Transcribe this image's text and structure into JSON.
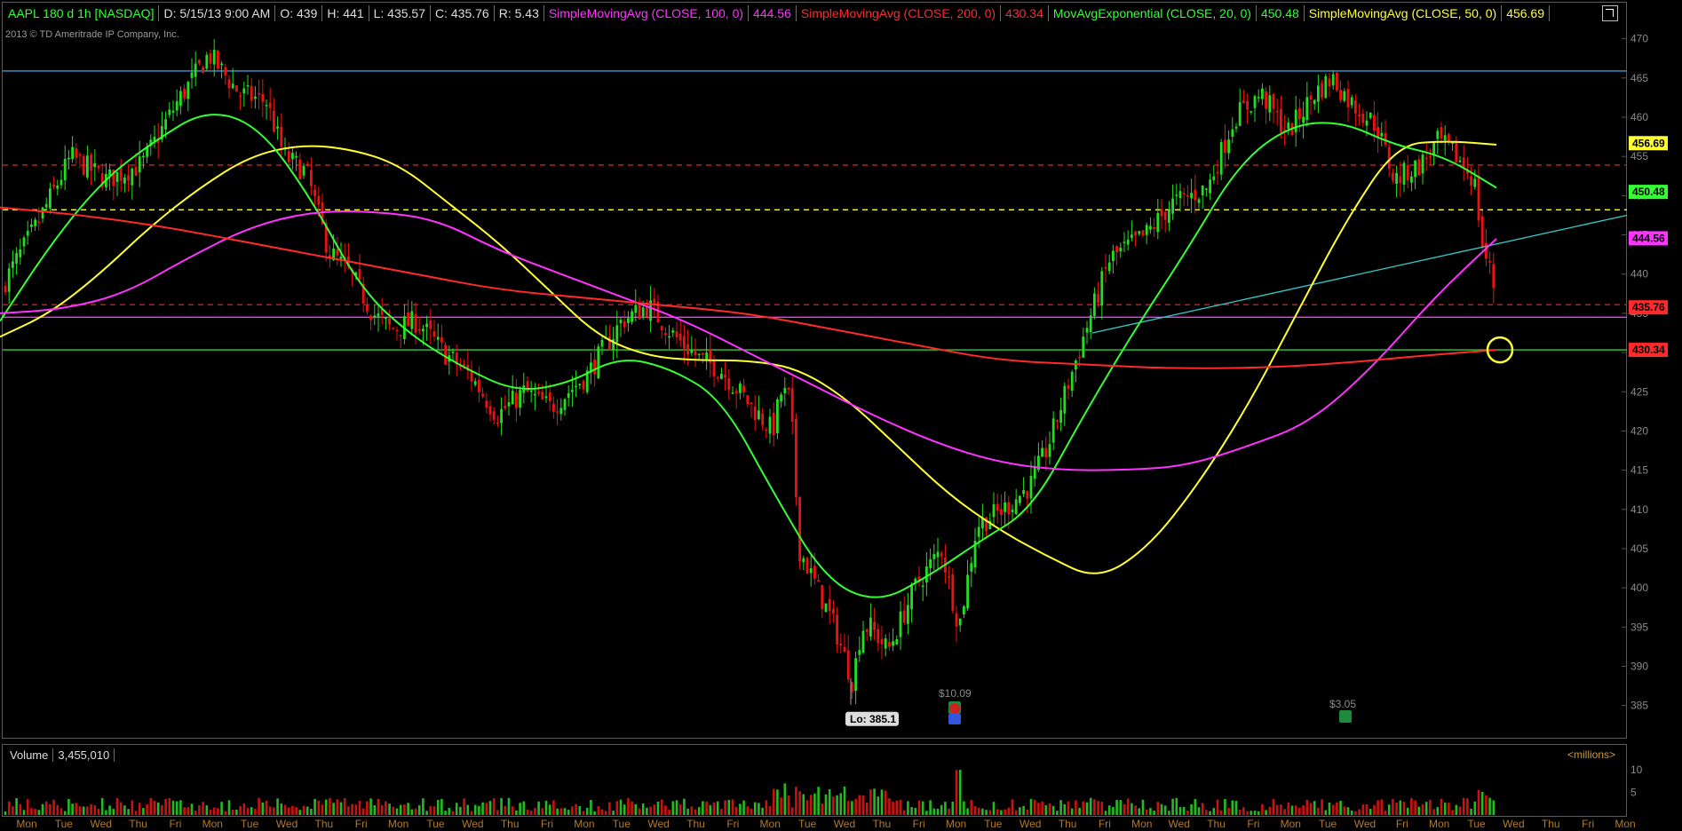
{
  "header": {
    "symbol": "AAPL 180 d 1h [NASDAQ]",
    "date": "D: 5/15/13 9:00 AM",
    "open": "O: 439",
    "high": "H: 441",
    "low": "L: 435.57",
    "close": "C: 435.76",
    "range": "R: 5.43",
    "studies": [
      {
        "label": "SimpleMovingAvg (CLOSE, 100, 0)",
        "value": "444.56",
        "color": "#ff33ff"
      },
      {
        "label": "SimpleMovingAvg (CLOSE, 200, 0)",
        "value": "430.34",
        "color": "#ff2a2a"
      },
      {
        "label": "MovAvgExponential (CLOSE, 20, 0)",
        "value": "450.48",
        "color": "#33ff33"
      },
      {
        "label": "SimpleMovingAvg (CLOSE, 50, 0)",
        "value": "456.69",
        "color": "#ffff33"
      }
    ]
  },
  "copyright": "2013 © TD Ameritrade IP Company, Inc.",
  "volume_panel": {
    "label": "Volume",
    "value": "3,455,010",
    "units": "<millions>",
    "y_ticks": [
      "10",
      "5"
    ]
  },
  "chart_data": {
    "type": "candlestick",
    "y_ticks": [
      470,
      465,
      460,
      455,
      450,
      445,
      440,
      435,
      430,
      425,
      420,
      415,
      410,
      405,
      400,
      395,
      390,
      385
    ],
    "ylim": [
      381,
      472
    ],
    "price_tags": [
      {
        "value": 456.69,
        "label": "456.69",
        "color": "#ffff33"
      },
      {
        "value": 450.48,
        "label": "450.48",
        "color": "#33ff33"
      },
      {
        "value": 444.56,
        "label": "444.56",
        "color": "#ff33ff"
      },
      {
        "value": 435.76,
        "label": "435.76",
        "color": "#ff2a2a"
      },
      {
        "value": 430.34,
        "label": "430.34",
        "color": "#ff2a2a"
      }
    ],
    "low_label": "Lo: 385.1",
    "low_value": 385.1,
    "dividends": [
      "$10.09",
      "$3.05"
    ],
    "day_labels": [
      "Mon",
      "Tue",
      "Wed",
      "Thu",
      "Fri",
      "Mon",
      "Tue",
      "Wed",
      "Thu",
      "Fri",
      "Mon",
      "Tue",
      "Wed",
      "Thu",
      "Fri",
      "Mon",
      "Tue",
      "Wed",
      "Thu",
      "Fri",
      "Mon",
      "Tue",
      "Wed",
      "Thu",
      "Fri",
      "Mon",
      "Tue",
      "Wed",
      "Thu",
      "Fri",
      "Mon",
      "Wed",
      "Thu",
      "Fri",
      "Mon",
      "Tue",
      "Wed",
      "Fri",
      "Mon",
      "Tue",
      "Wed",
      "Thu",
      "Fri",
      "Mon"
    ],
    "horizontal_lines": [
      {
        "value": 465.9,
        "color": "#3a9ad9",
        "style": "solid"
      },
      {
        "value": 453.9,
        "color": "#cc2222",
        "style": "dashed"
      },
      {
        "value": 448.2,
        "color": "#ffff33",
        "style": "dashed"
      },
      {
        "value": 436.1,
        "color": "#cc2222",
        "style": "dashed"
      },
      {
        "value": 434.5,
        "color": "#ff33ff",
        "style": "solid"
      },
      {
        "value": 430.34,
        "color": "#33cc33",
        "style": "solid"
      }
    ],
    "trendline": {
      "from_price": 432.5,
      "to_price": 447.5,
      "color": "#33cccc"
    },
    "series": [
      {
        "name": "SimpleMovingAvg (CLOSE, 50, 0)",
        "color": "#ffff33",
        "values": [
          432,
          435,
          440,
          446,
          451,
          455,
          456.5,
          456,
          454,
          449,
          444,
          438,
          432,
          429.5,
          429,
          429,
          428,
          424,
          418,
          412,
          407.5,
          404,
          401,
          405,
          413,
          423,
          435,
          447,
          456.5,
          457,
          456.5
        ]
      },
      {
        "name": "MovAvgExponential (CLOSE, 20, 0)",
        "color": "#33ff33",
        "values": [
          434,
          444,
          452,
          457,
          461,
          459,
          450,
          438,
          432,
          428,
          425,
          426,
          429.5,
          428,
          424,
          412,
          401,
          398,
          401.5,
          406,
          410,
          422,
          433,
          443,
          454,
          459,
          459.5,
          456.5,
          455,
          451
        ]
      },
      {
        "name": "SimpleMovingAvg (CLOSE, 100, 0)",
        "color": "#ff33ff",
        "values": [
          435,
          435.5,
          437.5,
          442,
          446,
          448,
          448,
          447,
          443,
          440,
          437,
          434,
          430,
          426,
          422,
          418.5,
          416,
          415,
          415,
          415.5,
          418,
          421,
          428,
          437,
          444.5
        ]
      },
      {
        "name": "SimpleMovingAvg (CLOSE, 200, 0)",
        "color": "#ff2a2a",
        "values": [
          448.5,
          447.5,
          446,
          444,
          442,
          440,
          438,
          437,
          436,
          435,
          433,
          431,
          429,
          428.5,
          428,
          428,
          428.5,
          429.5,
          430.34
        ]
      }
    ]
  }
}
